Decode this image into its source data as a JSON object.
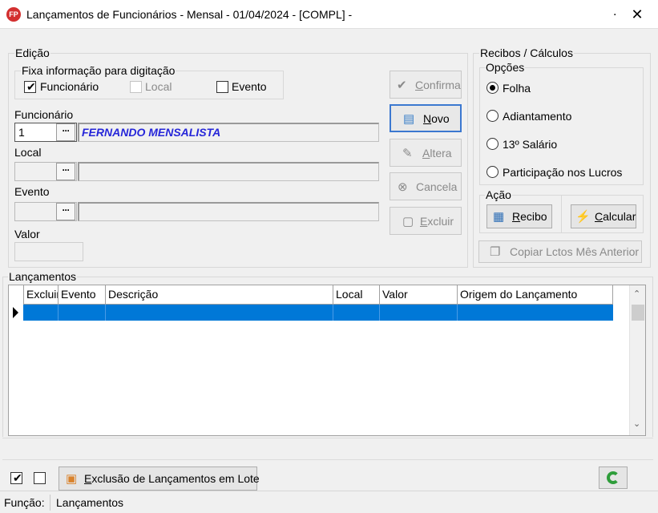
{
  "window": {
    "title": "Lançamentos de Funcionários - Mensal -  01/04/2024 - [COMPL] -",
    "app_icon": "FP",
    "minimize_glyph": ".",
    "close_glyph": "✕"
  },
  "edicao": {
    "group_label": "Edição",
    "fixa_label": "Fixa informação para digitação",
    "fixa_options": [
      {
        "label": "Funcionário",
        "checked": true,
        "enabled": true
      },
      {
        "label": "Local",
        "checked": false,
        "enabled": false
      },
      {
        "label": "Evento",
        "checked": false,
        "enabled": true
      }
    ],
    "funcionario_label": "Funcionário",
    "funcionario_code": "1",
    "funcionario_name": "FERNANDO MENSALISTA",
    "local_label": "Local",
    "local_code": "",
    "local_name": "",
    "evento_label": "Evento",
    "evento_code": "",
    "evento_name": "",
    "valor_label": "Valor",
    "valor_value": "",
    "lookup_glyph": "···"
  },
  "actions": {
    "confirma": {
      "prefix": "",
      "key": "C",
      "rest": "onfirma"
    },
    "novo": {
      "prefix": "",
      "key": "N",
      "rest": "ovo"
    },
    "altera": {
      "prefix": "",
      "key": "A",
      "rest": "ltera"
    },
    "cancela": {
      "prefix": "Cancela",
      "key": "",
      "rest": ""
    },
    "excluir": {
      "prefix": "",
      "key": "E",
      "rest": "xcluir"
    }
  },
  "recibos": {
    "group_label": "Recibos / Cálculos",
    "opcoes_label": "Opções",
    "options": [
      {
        "label": "Folha",
        "selected": true
      },
      {
        "label": "Adiantamento",
        "selected": false
      },
      {
        "label": "13º Salário",
        "selected": false
      },
      {
        "label": "Participação nos Lucros",
        "selected": false
      }
    ],
    "acao_label": "Ação",
    "recibo": {
      "prefix": "",
      "key": "R",
      "rest": "ecibo"
    },
    "calcular": {
      "prefix": "",
      "key": "C",
      "rest": "alcular"
    },
    "copiar": "Copiar Lctos Mês Anterior"
  },
  "lancamentos": {
    "group_label": "Lançamentos",
    "columns": [
      "Excluir",
      "Evento",
      "Descrição",
      "Local",
      "Valor",
      "Origem do Lançamento"
    ],
    "rows": [
      [
        "",
        "",
        "",
        "",
        "",
        ""
      ]
    ]
  },
  "bottom": {
    "check1_checked": true,
    "check2_checked": false,
    "lote_button": {
      "prefix": "",
      "key": "E",
      "rest": "xclusão de Lançamentos em Lote"
    }
  },
  "status": {
    "funcao_label": "Função:",
    "funcao_value": "Lançamentos"
  },
  "colors": {
    "selection": "#0078d7",
    "employee_name": "#2626d9",
    "focus_border": "#3b78d0"
  }
}
